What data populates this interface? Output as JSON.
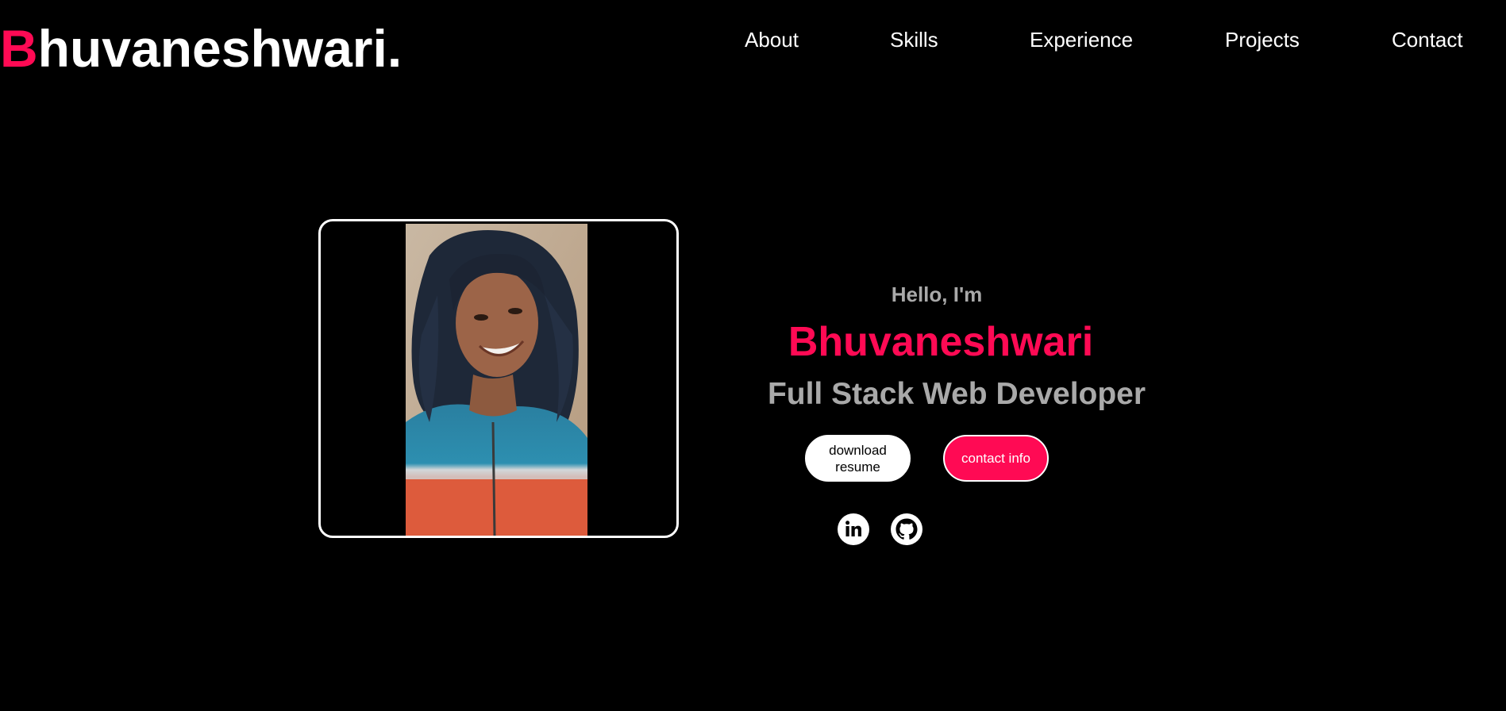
{
  "header": {
    "logo_initial": "B",
    "logo_rest": "huvaneshwari.",
    "nav": [
      {
        "label": "About"
      },
      {
        "label": "Skills"
      },
      {
        "label": "Experience"
      },
      {
        "label": "Projects"
      },
      {
        "label": "Contact"
      }
    ]
  },
  "hero": {
    "greeting": "Hello, I'm",
    "name": "Bhuvaneshwari",
    "role": "Full Stack Web Developer",
    "buttons": {
      "resume_label": "download resume",
      "contact_label": "contact info"
    },
    "social": [
      {
        "icon": "linkedin-icon"
      },
      {
        "icon": "github-icon"
      }
    ]
  },
  "colors": {
    "background": "#000000",
    "accent": "#ff0a54",
    "muted_text": "#a9a9a9",
    "text": "#ffffff"
  }
}
